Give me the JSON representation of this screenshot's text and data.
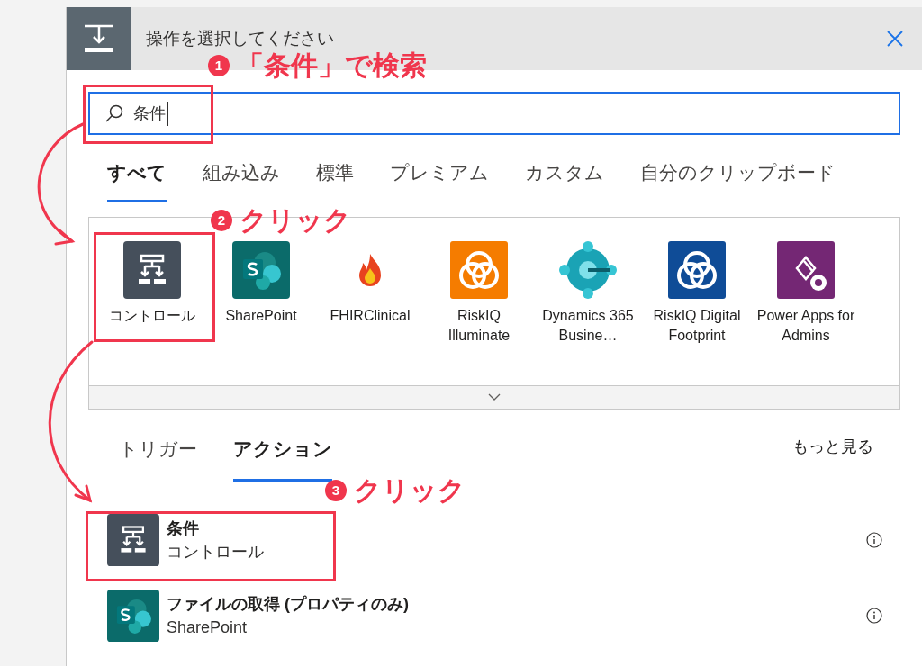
{
  "dialog": {
    "title": "操作を選択してください"
  },
  "search": {
    "value": "条件"
  },
  "category_tabs": [
    {
      "label": "すべて",
      "selected": true
    },
    {
      "label": "組み込み",
      "selected": false
    },
    {
      "label": "標準",
      "selected": false
    },
    {
      "label": "プレミアム",
      "selected": false
    },
    {
      "label": "カスタム",
      "selected": false
    },
    {
      "label": "自分のクリップボード",
      "selected": false
    }
  ],
  "connectors": [
    {
      "name": "コントロール",
      "kind": "control"
    },
    {
      "name": "SharePoint",
      "kind": "sharepoint"
    },
    {
      "name": "FHIRClinical",
      "kind": "flame"
    },
    {
      "name": "RiskIQ Illuminate",
      "kind": "rings_orange"
    },
    {
      "name": "Dynamics 365 Busine…",
      "kind": "hub"
    },
    {
      "name": "RiskIQ Digital Footprint",
      "kind": "rings_blue"
    },
    {
      "name": "Power Apps for Admins",
      "kind": "powerapps"
    }
  ],
  "action_tabs": [
    {
      "label": "トリガー",
      "selected": false
    },
    {
      "label": "アクション",
      "selected": true
    }
  ],
  "more_link": "もっと見る",
  "actions": [
    {
      "title": "条件",
      "subtitle": "コントロール",
      "kind": "control"
    },
    {
      "title": "ファイルの取得 (プロパティのみ)",
      "subtitle": "SharePoint",
      "kind": "sharepoint"
    }
  ],
  "annotations": [
    {
      "number": "1",
      "text": "「条件」で検索"
    },
    {
      "number": "2",
      "text": "クリック"
    },
    {
      "number": "3",
      "text": "クリック"
    }
  ]
}
